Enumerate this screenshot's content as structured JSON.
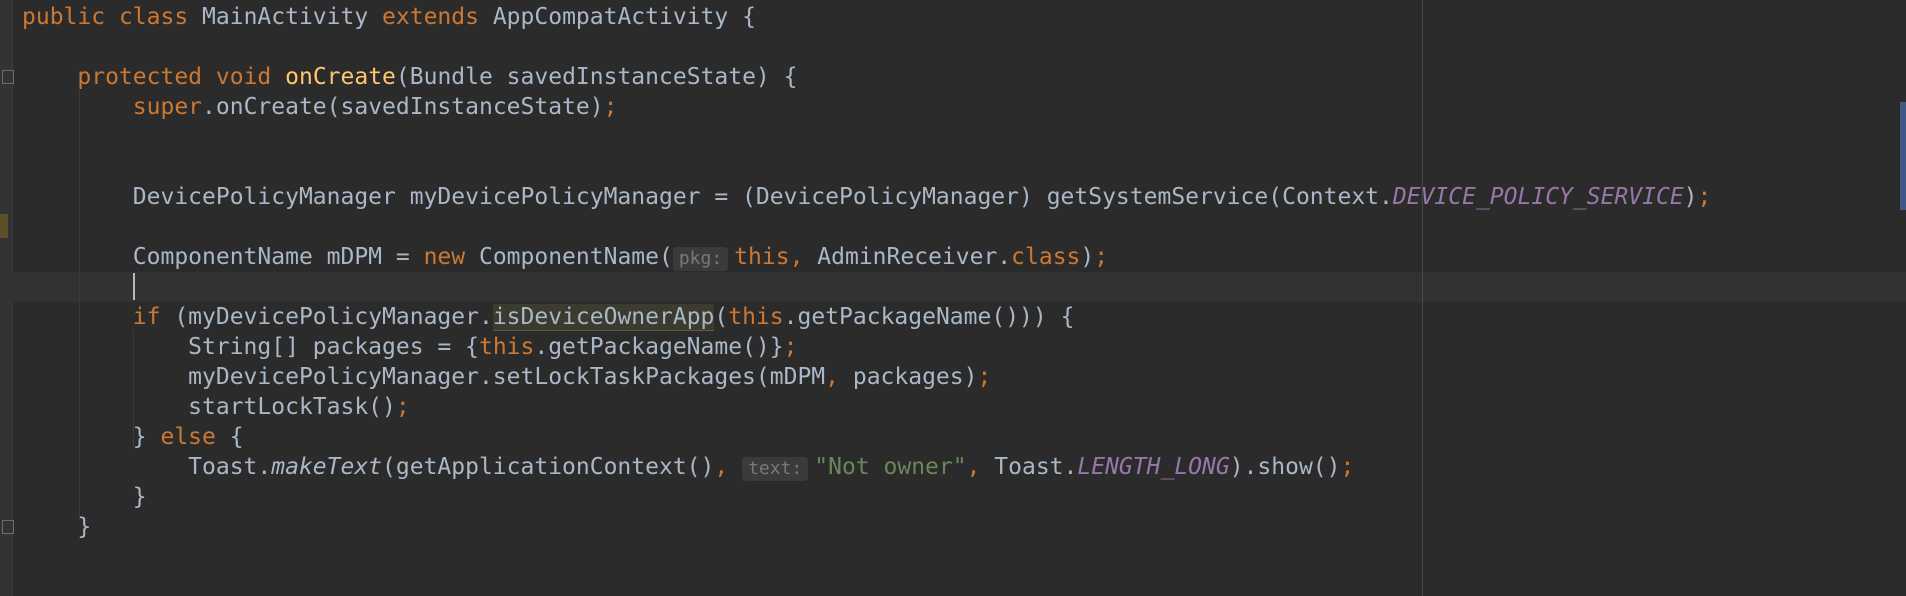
{
  "editor": {
    "lines": [
      {
        "segs": [
          {
            "t": "public ",
            "c": "kw"
          },
          {
            "t": "class ",
            "c": "kw"
          },
          {
            "t": "MainActivity "
          },
          {
            "t": "extends ",
            "c": "kw"
          },
          {
            "t": "AppCompatActivity {"
          }
        ]
      },
      {
        "segs": []
      },
      {
        "segs": [
          {
            "t": "    "
          },
          {
            "t": "protected ",
            "c": "kw"
          },
          {
            "t": "void ",
            "c": "kw"
          },
          {
            "t": "onCreate",
            "c": "fn"
          },
          {
            "t": "(Bundle savedInstanceState) {"
          }
        ]
      },
      {
        "segs": [
          {
            "t": "        "
          },
          {
            "t": "super",
            "c": "kw"
          },
          {
            "t": ".onCreate(savedInstanceState)"
          },
          {
            "t": ";",
            "c": "kw"
          }
        ]
      },
      {
        "segs": []
      },
      {
        "segs": []
      },
      {
        "segs": [
          {
            "t": "        DevicePolicyManager myDevicePolicyManager = (DevicePolicyManager) getSystemService(Context."
          },
          {
            "t": "DEVICE_POLICY_SERVICE",
            "c": "cnst"
          },
          {
            "t": ")"
          },
          {
            "t": ";",
            "c": "kw"
          }
        ]
      },
      {
        "segs": []
      },
      {
        "segs": [
          {
            "t": "        ComponentName mDPM = "
          },
          {
            "t": "new ",
            "c": "kw"
          },
          {
            "t": "ComponentName("
          },
          {
            "t": "pkg:",
            "hint": true
          },
          {
            "t": "this",
            "c": "kw"
          },
          {
            "t": ", ",
            "c": "kw"
          },
          {
            "t": "AdminReceiver."
          },
          {
            "t": "class",
            "c": "kw"
          },
          {
            "t": ")"
          },
          {
            "t": ";",
            "c": "kw"
          }
        ]
      },
      {
        "segs": []
      },
      {
        "segs": [
          {
            "t": "        "
          },
          {
            "t": "if ",
            "c": "kw"
          },
          {
            "t": "(myDevicePolicyManager."
          },
          {
            "t": "isDeviceOwnerApp",
            "c": "hl"
          },
          {
            "t": "("
          },
          {
            "t": "this",
            "c": "kw"
          },
          {
            "t": ".getPackageName())) {"
          }
        ]
      },
      {
        "segs": [
          {
            "t": "            String[] packages = {"
          },
          {
            "t": "this",
            "c": "kw"
          },
          {
            "t": ".getPackageName()}"
          },
          {
            "t": ";",
            "c": "kw"
          }
        ]
      },
      {
        "segs": [
          {
            "t": "            myDevicePolicyManager.setLockTaskPackages(mDPM"
          },
          {
            "t": ", ",
            "c": "kw"
          },
          {
            "t": "packages)"
          },
          {
            "t": ";",
            "c": "kw"
          }
        ]
      },
      {
        "segs": [
          {
            "t": "            startLockTask()"
          },
          {
            "t": ";",
            "c": "kw"
          }
        ]
      },
      {
        "segs": [
          {
            "t": "        } "
          },
          {
            "t": "else ",
            "c": "kw"
          },
          {
            "t": "{"
          }
        ]
      },
      {
        "segs": [
          {
            "t": "            Toast."
          },
          {
            "t": "makeText",
            "c": "it"
          },
          {
            "t": "(getApplicationContext()"
          },
          {
            "t": ", ",
            "c": "kw"
          },
          {
            "t": "text:",
            "hint": true
          },
          {
            "t": "\"Not owner\"",
            "c": "str"
          },
          {
            "t": ", ",
            "c": "kw"
          },
          {
            "t": "Toast."
          },
          {
            "t": "LENGTH_LONG",
            "c": "cnst"
          },
          {
            "t": ").show()"
          },
          {
            "t": ";",
            "c": "kw"
          }
        ]
      },
      {
        "segs": [
          {
            "t": "        }"
          }
        ]
      },
      {
        "segs": [
          {
            "t": "    }"
          }
        ]
      }
    ],
    "colors": {
      "background": "#2b2b2b",
      "text": "#a9b7c6",
      "keyword": "#cc7832",
      "method_declaration": "#ffc66d",
      "constant": "#9876aa",
      "string": "#6a8759",
      "caret_line": "#323232"
    }
  }
}
